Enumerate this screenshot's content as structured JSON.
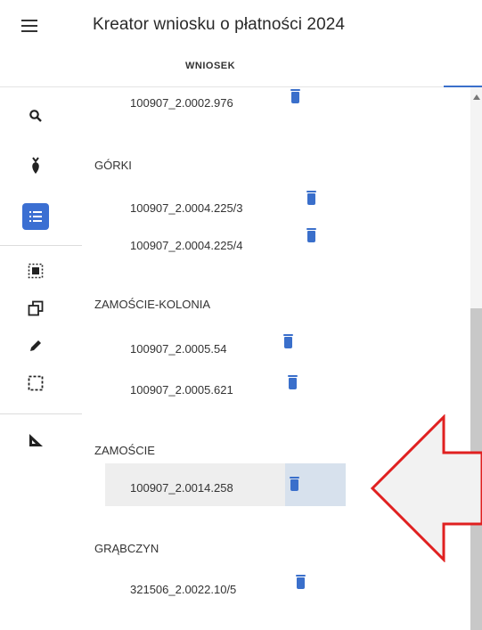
{
  "header": {
    "title": "Kreator wniosku o płatności 2024",
    "menu_icon": "hamburger-menu-icon"
  },
  "tabs": [
    {
      "label": "WNIOSEK",
      "active": true
    }
  ],
  "toolbar": {
    "items": [
      {
        "icon": "search-icon"
      },
      {
        "icon": "beet-icon"
      },
      {
        "icon": "list-icon",
        "active": true
      },
      {
        "icon": "select-parcel-icon"
      },
      {
        "icon": "copy-icon"
      },
      {
        "icon": "pencil-icon"
      },
      {
        "icon": "dashed-selection-icon"
      },
      {
        "icon": "ruler-icon"
      }
    ]
  },
  "list": {
    "top_item": {
      "code": "100907_2.0002.976"
    },
    "groups": [
      {
        "name": "GÓRKI",
        "items": [
          "100907_2.0004.225/3",
          "100907_2.0004.225/4"
        ]
      },
      {
        "name": "ZAMOŚCIE-KOLONIA",
        "items": [
          "100907_2.0005.54",
          "100907_2.0005.621"
        ]
      },
      {
        "name": "ZAMOŚCIE",
        "items": [
          "100907_2.0014.258"
        ],
        "selected_index": 0
      },
      {
        "name": "GRĄBCZYN",
        "items": [
          "321506_2.0022.10/5"
        ]
      }
    ]
  },
  "colors": {
    "accent": "#3a6fcb",
    "arrow_outline": "#e02020",
    "arrow_fill": "#f2f2f2"
  }
}
